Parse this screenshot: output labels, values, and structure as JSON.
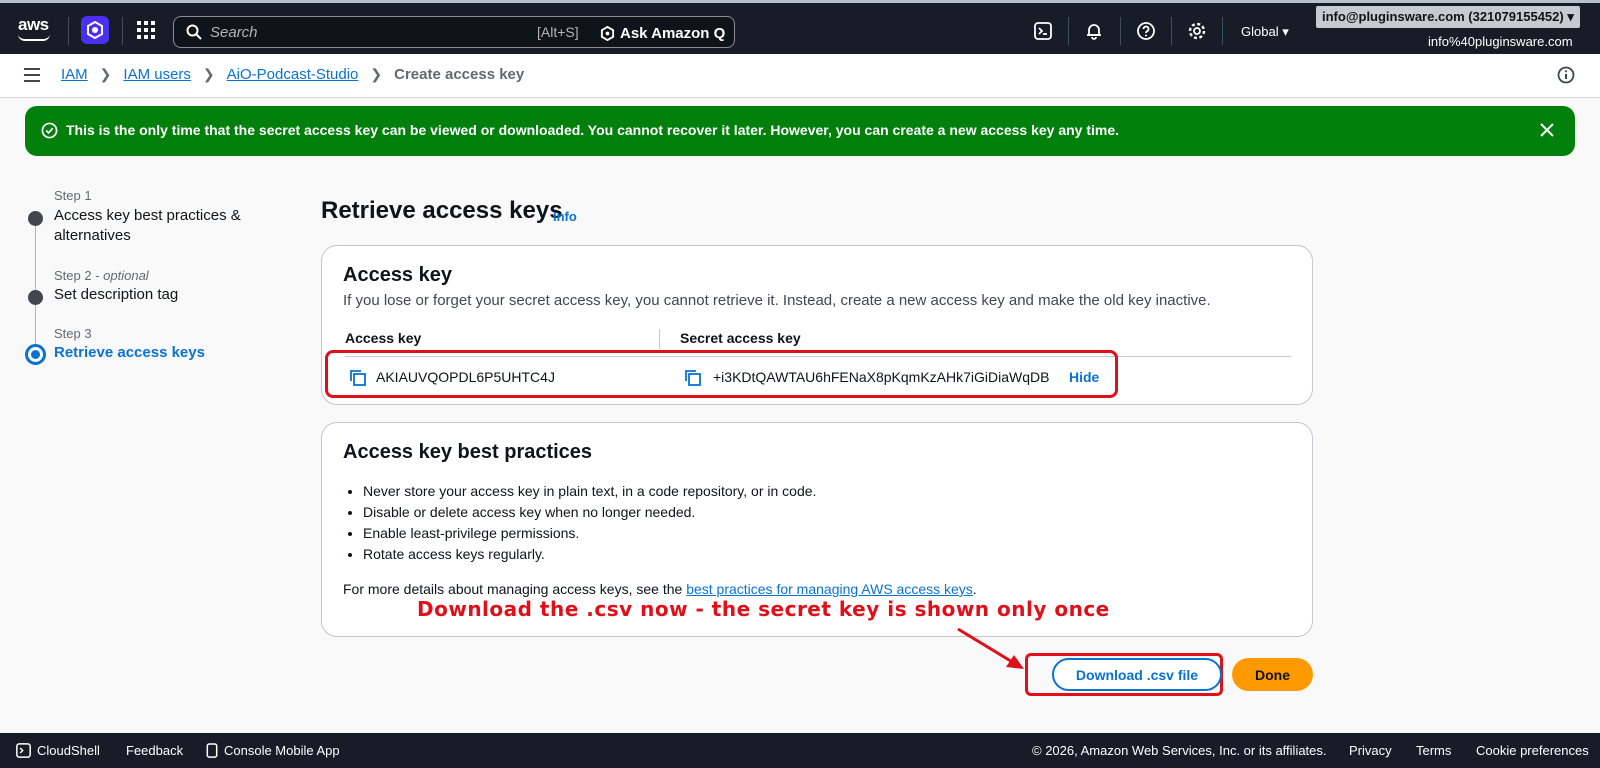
{
  "topnav": {
    "logo_text": "aws",
    "search_placeholder": "Search",
    "search_shortcut": "[Alt+S]",
    "ask_q_label": "Ask Amazon Q",
    "region": "Global ▾",
    "account": "info@pluginsware.com (321079155452) ▾",
    "account_sub": "info%40pluginsware.com"
  },
  "breadcrumb": {
    "items": [
      "IAM",
      "IAM users",
      "AiO-Podcast-Studio"
    ],
    "current": "Create access key"
  },
  "flash": {
    "message": "This is the only time that the secret access key can be viewed or downloaded. You cannot recover it later. However, you can create a new access key any time."
  },
  "steps": [
    {
      "label": "Step 1",
      "title": "Access key best practices & alternatives"
    },
    {
      "label": "Step 2",
      "optional": "optional",
      "title": "Set description tag"
    },
    {
      "label": "Step 3",
      "title": "Retrieve access keys"
    }
  ],
  "main": {
    "title": "Retrieve access keys",
    "info": "Info"
  },
  "access_key_card": {
    "title": "Access key",
    "description": "If you lose or forget your secret access key, you cannot retrieve it. Instead, create a new access key and make the old key inactive.",
    "col_access_key": "Access key",
    "col_secret": "Secret access key",
    "access_key_value": "AKIAUVQOPDL6P5UHTC4J",
    "secret_value": "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",
    "hide_label": "Hide"
  },
  "best_practices": {
    "title": "Access key best practices",
    "items": [
      "Never store your access key in plain text, in a code repository, or in code.",
      "Disable or delete access key when no longer needed.",
      "Enable least-privilege permissions.",
      "Rotate access keys regularly."
    ],
    "more_prefix": "For more details about managing access keys, see the ",
    "more_link": "best practices for managing AWS access keys",
    "more_suffix": "."
  },
  "annotation": "Download the .csv now - the secret key is shown only once",
  "actions": {
    "download": "Download .csv file",
    "done": "Done"
  },
  "footer": {
    "cloudshell": "CloudShell",
    "feedback": "Feedback",
    "mobile": "Console Mobile App",
    "copyright": "© 2026, Amazon Web Services, Inc. or its affiliates.",
    "privacy": "Privacy",
    "terms": "Terms",
    "cookies": "Cookie preferences"
  },
  "colors": {
    "accent": "#0972d3",
    "success": "#037f0c",
    "nav_bg": "#161d26",
    "primary_button": "#ff9900",
    "annotation": "#e0101a"
  }
}
